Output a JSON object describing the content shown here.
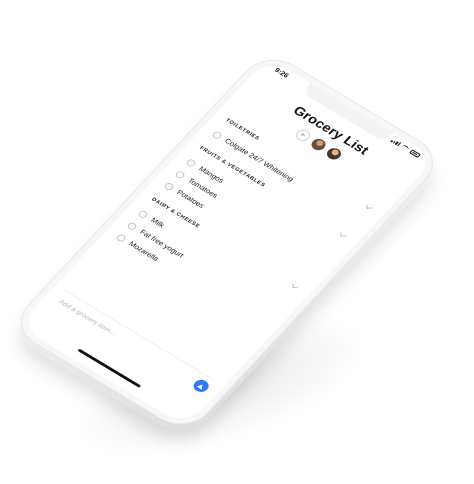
{
  "status_bar": {
    "time": "9:26"
  },
  "header": {
    "title": "Grocery List",
    "add_collaborator": "+"
  },
  "sections": [
    {
      "title": "TOILETRIES",
      "items": [
        "Colgate 24/7 Whitening"
      ]
    },
    {
      "title": "FRUITS & VEGETABLES",
      "items": [
        "Mangos",
        "Tomatoes",
        "Potatoes"
      ]
    },
    {
      "title": "DAIRY & CHEESE",
      "items": [
        "Milk",
        "Fat free yogurt",
        "Mozarella"
      ]
    }
  ],
  "composer": {
    "placeholder": "Add a grocery item..."
  },
  "colors": {
    "accent": "#2f7cf6",
    "text": "#111111",
    "checkbox_border": "#bfc2c8"
  },
  "icons": {
    "send": "arrow-up-icon",
    "collapse": "chevron-down-icon",
    "add_collaborator": "plus-icon"
  }
}
